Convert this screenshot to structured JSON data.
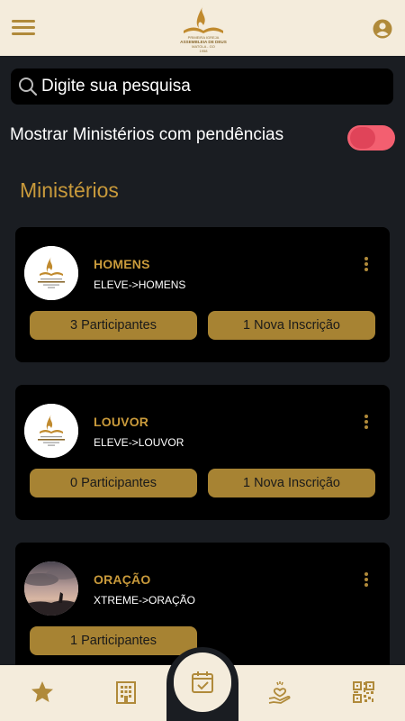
{
  "header": {
    "menu_icon": "hamburger-menu-icon",
    "logo_icon": "church-flame-bible-logo",
    "logo_text": [
      "PRIMEIRA IGREJA",
      "ASSEMBLEIA DE DEUS",
      "MATOLA - GO",
      "1958"
    ],
    "account_icon": "user-account-icon"
  },
  "search": {
    "placeholder": "Digite sua pesquisa",
    "icon": "search-icon"
  },
  "filter": {
    "label": "Mostrar Ministérios com pendências",
    "enabled": true,
    "color": "#f35f70"
  },
  "section": {
    "title": "Ministérios"
  },
  "ministries": [
    {
      "name": "HOMENS",
      "path": "ELEVE->HOMENS",
      "participants": "3 Participantes",
      "new_signups": "1 Nova Inscrição",
      "avatar": "church-logo"
    },
    {
      "name": "LOUVOR",
      "path": "ELEVE->LOUVOR",
      "participants": "0 Participantes",
      "new_signups": "1 Nova Inscrição",
      "avatar": "church-logo"
    },
    {
      "name": "ORAÇÃO",
      "path": "XTREME->ORAÇÃO",
      "participants": "1 Participantes",
      "new_signups": "",
      "avatar": "praying-silhouette-photo"
    }
  ],
  "bottom_nav": {
    "items": [
      "star-icon",
      "building-icon",
      "calendar-check-icon",
      "heart-hand-icon",
      "qr-code-icon"
    ],
    "active": "calendar-check-icon"
  },
  "colors": {
    "accent": "#c99a3b",
    "button": "#a78333",
    "bar": "#f4ecdc",
    "background": "#1a1d22"
  }
}
